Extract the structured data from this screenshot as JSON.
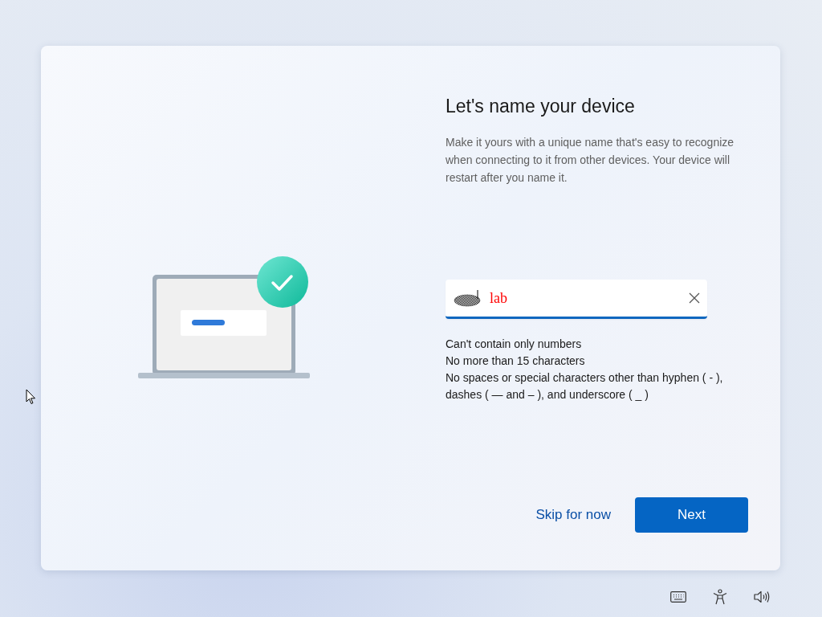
{
  "title": "Let's name your device",
  "description": "Make it yours with a unique name that's easy to recognize when connecting to it from other devices. Your device will restart after you name it.",
  "name_field": {
    "value": "lab"
  },
  "rules": [
    "Can't contain only numbers",
    "No more than 15 characters",
    "No spaces or special characters other than hyphen ( - ), dashes ( — and – ), and underscore ( _ )"
  ],
  "buttons": [
    {
      "kind": "link",
      "label": "Skip for now"
    },
    {
      "kind": "primary",
      "label": "Next"
    }
  ]
}
